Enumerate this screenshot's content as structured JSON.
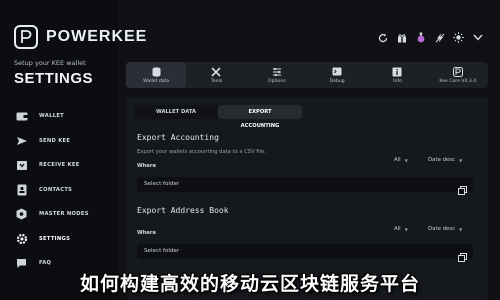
{
  "brand": {
    "name": "POWERKEE"
  },
  "header": {
    "subtitle": "Setup your KEE wallet",
    "title": "SETTINGS"
  },
  "sidebar": {
    "items": [
      {
        "label": "WALLET",
        "icon": "wallet-icon"
      },
      {
        "label": "SEND KEE",
        "icon": "send-icon"
      },
      {
        "label": "RECEIVE KEE",
        "icon": "receive-icon"
      },
      {
        "label": "CONTACTS",
        "icon": "contacts-icon"
      },
      {
        "label": "MASTER NODES",
        "icon": "masternodes-icon"
      },
      {
        "label": "SETTINGS",
        "icon": "gear-icon",
        "active": true
      },
      {
        "label": "FAQ",
        "icon": "faq-icon"
      }
    ]
  },
  "topbar": {
    "icons": [
      "refresh-icon",
      "gift-icon",
      "potion-icon",
      "lightning-icon",
      "sun-icon",
      "chevron-down-icon"
    ]
  },
  "toolbar": {
    "tabs": [
      {
        "label": "Wallet data",
        "icon": "database-icon",
        "active": true
      },
      {
        "label": "Tools",
        "icon": "tools-icon"
      },
      {
        "label": "Options",
        "icon": "options-icon"
      },
      {
        "label": "Debug",
        "icon": "debug-icon"
      },
      {
        "label": "Info",
        "icon": "info-icon"
      },
      {
        "label": "Kee Core V4.3.4",
        "icon": "kee-core-icon"
      }
    ]
  },
  "subtabs": [
    {
      "label": "WALLET DATA"
    },
    {
      "label": "EXPORT ACCOUNTING",
      "active": true
    }
  ],
  "export_accounting": {
    "title": "Export Accounting",
    "description": "Export your wallets accounting data to a CSV file.",
    "where_label": "Where",
    "filter_value": "All",
    "sort_value": "Date desc",
    "folder_placeholder": "Select folder"
  },
  "export_address_book": {
    "title": "Export Address Book",
    "where_label": "Where",
    "filter_value": "All",
    "sort_value": "Date desc",
    "folder_placeholder": "Select folder"
  },
  "overlay": {
    "headline": "如何构建高效的移动云区块链服务平台"
  },
  "colors": {
    "background": "#0f1114",
    "panel": "#15181c",
    "toolbar": "#1d2024",
    "text": "#d9dde3"
  }
}
